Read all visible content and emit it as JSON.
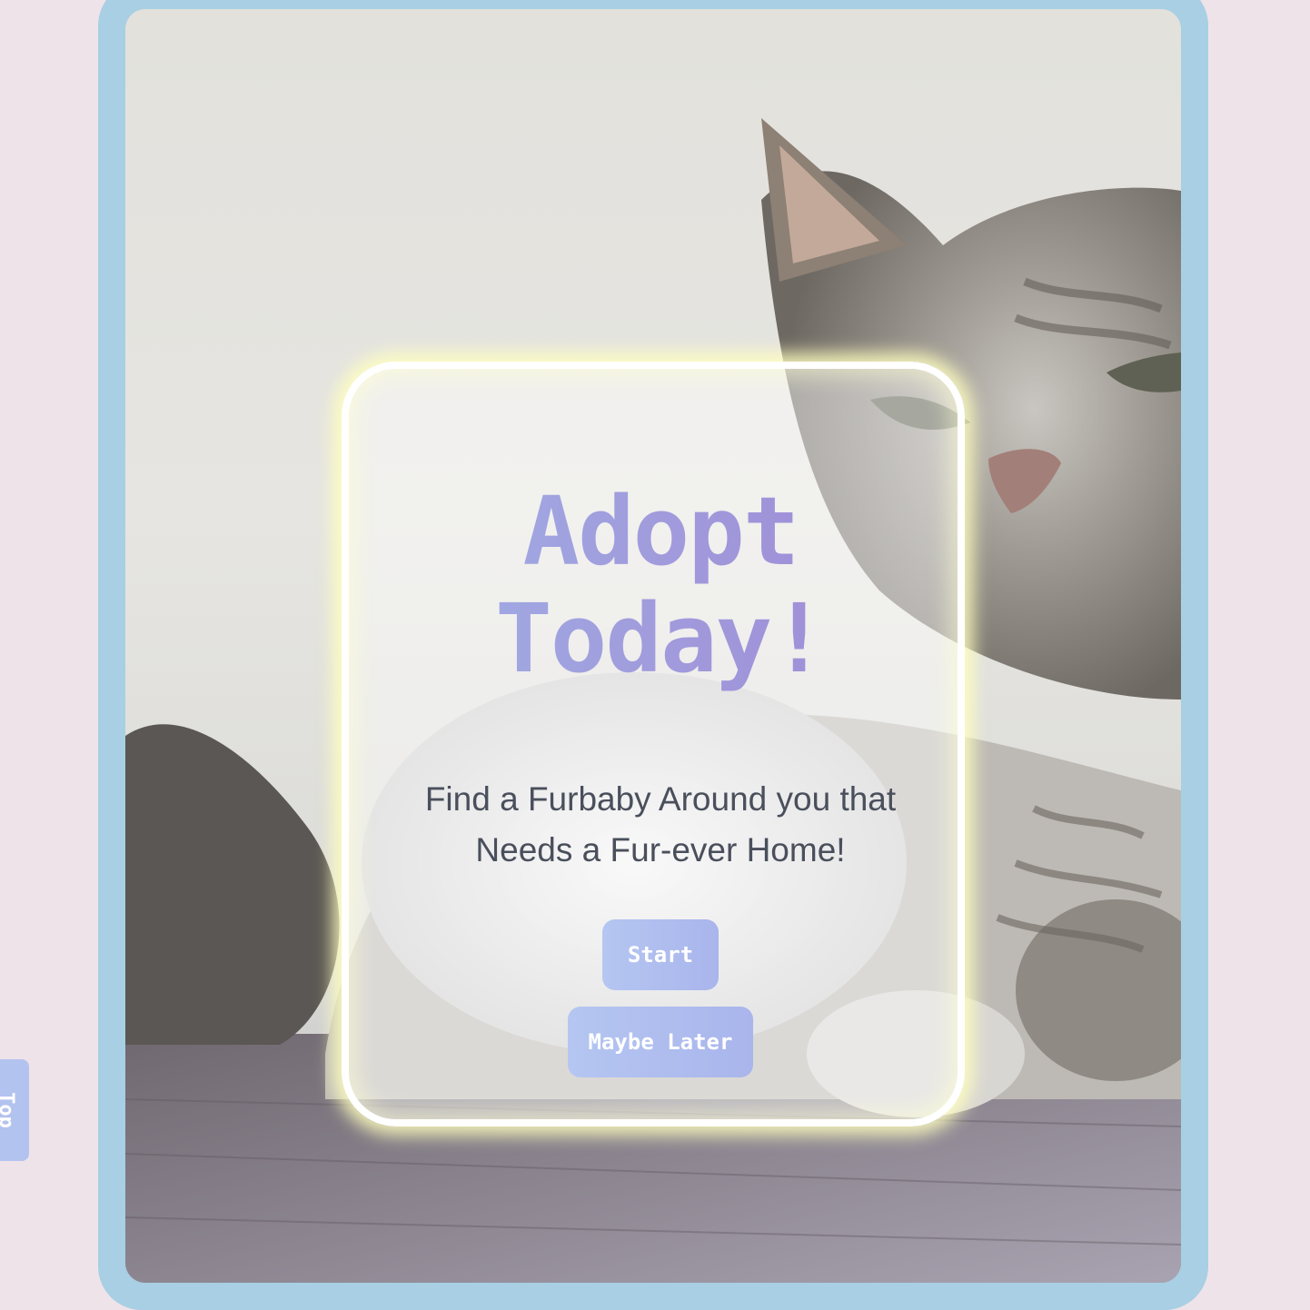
{
  "hero": {
    "headline_line1": "Adopt",
    "headline_line2": "Today!",
    "subtext": "Find a Furbaby Around you that Needs a Fur-ever Home!",
    "image_subject": "cat-photo"
  },
  "buttons": {
    "start_label": "Start",
    "maybe_later_label": "Maybe Later"
  },
  "side_tab": {
    "label": "Top"
  },
  "colors": {
    "page_background": "#efe3ea",
    "frame": "#a8cfe3",
    "headline_gradient_start": "#9fb2e6",
    "headline_gradient_end": "#9e86d4",
    "button_background": "#b3c3ef",
    "card_glow": "#ffffbe",
    "subtext": "#4a4f5c"
  }
}
